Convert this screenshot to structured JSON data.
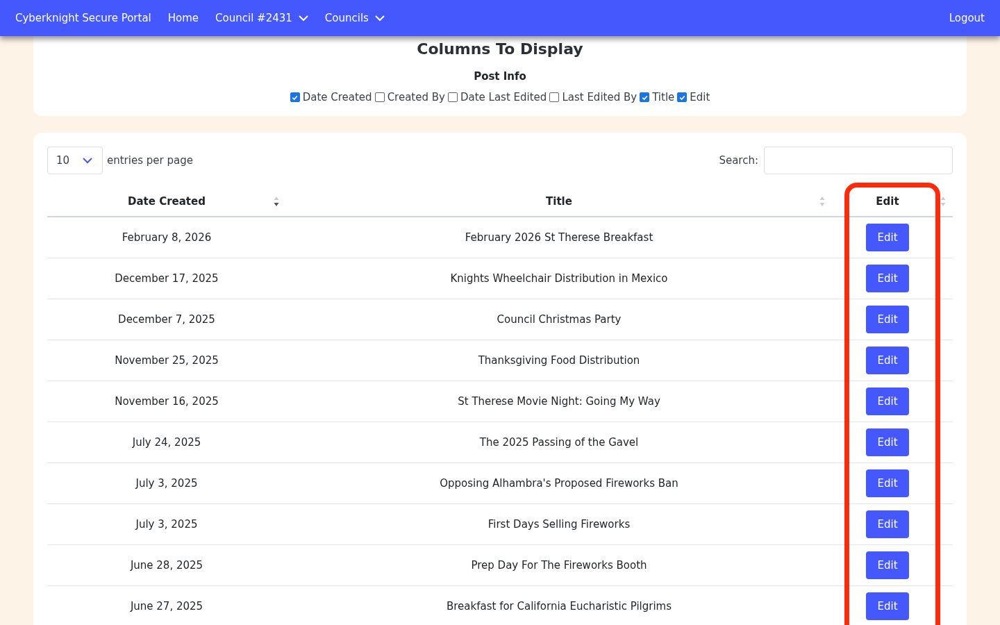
{
  "navbar": {
    "brand": "Cyberknight Secure Portal",
    "items": [
      {
        "label": "Home",
        "dropdown": false
      },
      {
        "label": "Council #2431",
        "dropdown": true
      },
      {
        "label": "Councils",
        "dropdown": true
      }
    ],
    "logout": "Logout"
  },
  "columns_panel": {
    "title": "Columns To Display",
    "group_title": "Post Info",
    "options": [
      {
        "label": "Date Created",
        "checked": true
      },
      {
        "label": "Created By",
        "checked": false
      },
      {
        "label": "Date Last Edited",
        "checked": false
      },
      {
        "label": "Last Edited By",
        "checked": false
      },
      {
        "label": "Title",
        "checked": true
      },
      {
        "label": "Edit",
        "checked": true
      }
    ]
  },
  "table_controls": {
    "entries_value": "10",
    "entries_label": "entries per page",
    "search_label": "Search:"
  },
  "table": {
    "columns": [
      {
        "label": "Date Created",
        "sorted": true
      },
      {
        "label": "Title",
        "sorted": false
      },
      {
        "label": "Edit",
        "sorted": false
      }
    ],
    "rows": [
      {
        "date": "February 8, 2026",
        "title": "February 2026 St Therese Breakfast",
        "action": "Edit"
      },
      {
        "date": "December 17, 2025",
        "title": "Knights Wheelchair Distribution in Mexico",
        "action": "Edit"
      },
      {
        "date": "December 7, 2025",
        "title": "Council Christmas Party",
        "action": "Edit"
      },
      {
        "date": "November 25, 2025",
        "title": "Thanksgiving Food Distribution",
        "action": "Edit"
      },
      {
        "date": "November 16, 2025",
        "title": "St Therese Movie Night: Going My Way",
        "action": "Edit"
      },
      {
        "date": "July 24, 2025",
        "title": "The 2025 Passing of the Gavel",
        "action": "Edit"
      },
      {
        "date": "July 3, 2025",
        "title": "Opposing Alhambra's Proposed Fireworks Ban",
        "action": "Edit"
      },
      {
        "date": "July 3, 2025",
        "title": "First Days Selling Fireworks",
        "action": "Edit"
      },
      {
        "date": "June 28, 2025",
        "title": "Prep Day For The Fireworks Booth",
        "action": "Edit"
      },
      {
        "date": "June 27, 2025",
        "title": "Breakfast for California Eucharistic Pilgrims",
        "action": "Edit"
      }
    ]
  }
}
